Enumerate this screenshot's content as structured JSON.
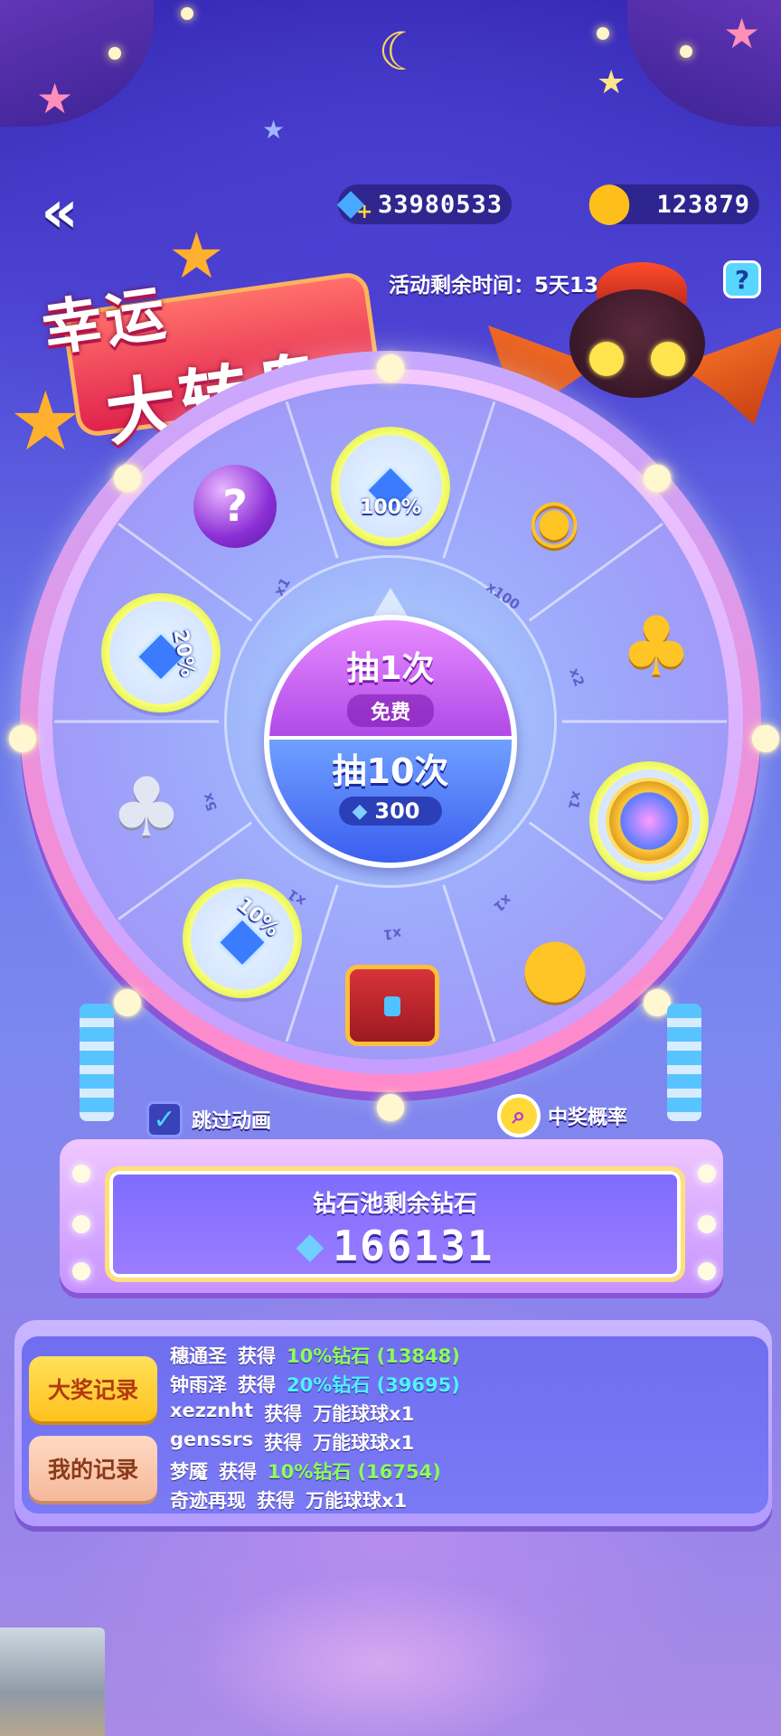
{
  "currency": {
    "diamonds": "33980533",
    "mushrooms": "123879",
    "diamond_icon": "diamond-icon",
    "mushroom_icon": "mushroom-icon"
  },
  "timer_text": "活动剩余时间：5天13小时",
  "help_label": "?",
  "title": {
    "line1": "幸运",
    "line2": "大转盘"
  },
  "wheel": {
    "multipliers": [
      "x1",
      "x100",
      "x2",
      "x1",
      "x1",
      "x1",
      "5x",
      "x1"
    ],
    "rewards": [
      {
        "name": "diamond-pile-100",
        "label": "100%"
      },
      {
        "name": "gold-coins",
        "label": ""
      },
      {
        "name": "gold-mushroom",
        "label": ""
      },
      {
        "name": "swirl-token",
        "label": ""
      },
      {
        "name": "gold-trophy-ball",
        "label": ""
      },
      {
        "name": "red-treasure-chest",
        "label": ""
      },
      {
        "name": "diamond-pile-10",
        "label": "10%"
      },
      {
        "name": "silver-mushroom",
        "label": ""
      },
      {
        "name": "diamond-pile-20",
        "label": "20%"
      },
      {
        "name": "mystery-orb",
        "label": "?"
      }
    ]
  },
  "spin1": {
    "label": "抽1次",
    "sub": "免费"
  },
  "spin10": {
    "label": "抽10次",
    "cost": "300"
  },
  "skip_animation": "跳过动画",
  "win_probability": "中奖概率",
  "pool": {
    "label": "钻石池剩余钻石",
    "value": "166131"
  },
  "tabs": {
    "grand": "大奖记录",
    "mine": "我的记录"
  },
  "records": [
    {
      "user": "穗通圣",
      "verb": "获得",
      "item": "10%钻石 (13848)",
      "color": "green"
    },
    {
      "user": "钟雨泽",
      "verb": "获得",
      "item": "20%钻石 (39695)",
      "color": "cyan"
    },
    {
      "user": "xezznht",
      "verb": "获得",
      "item": "万能球球x1",
      "color": "white"
    },
    {
      "user": "genssrs",
      "verb": "获得",
      "item": "万能球球x1",
      "color": "white"
    },
    {
      "user": "梦魇",
      "verb": "获得",
      "item": "10%钻石 (16754)",
      "color": "green"
    },
    {
      "user": "奇迹再现",
      "verb": "获得",
      "item": "万能球球x1",
      "color": "white"
    }
  ]
}
